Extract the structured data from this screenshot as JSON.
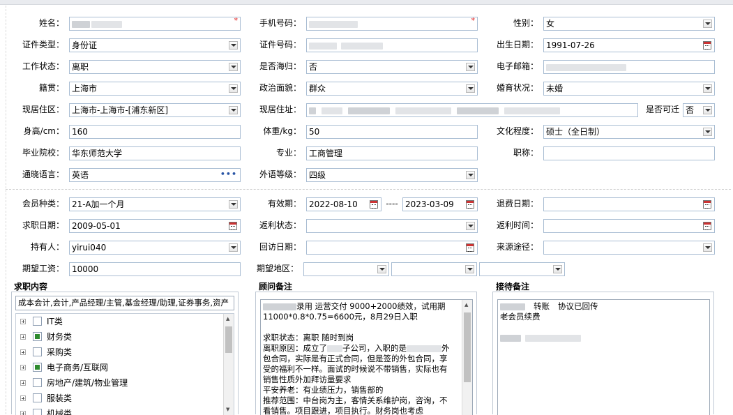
{
  "personal": {
    "name": {
      "label": "姓名："
    },
    "phone": {
      "label": "手机号码："
    },
    "gender": {
      "label": "性别：",
      "value": "女"
    },
    "id_type": {
      "label": "证件类型：",
      "value": "身份证"
    },
    "id_no": {
      "label": "证件号码："
    },
    "birth": {
      "label": "出生日期：",
      "value": "1991-07-26"
    },
    "work_status": {
      "label": "工作状态：",
      "value": "离职"
    },
    "overseas": {
      "label": "是否海归：",
      "value": "否"
    },
    "email": {
      "label": "电子邮箱："
    },
    "origin": {
      "label": "籍贯：",
      "value": "上海市"
    },
    "political": {
      "label": "政治面貌：",
      "value": "群众"
    },
    "marital": {
      "label": "婚育状况：",
      "value": "未婚"
    },
    "residence_area": {
      "label": "现居住区：",
      "value": "上海市-上海市-[浦东新区]"
    },
    "residence_addr": {
      "label": "现居住址："
    },
    "relocate": {
      "label": "是否可迁",
      "value": "否"
    },
    "height": {
      "label": "身高/cm：",
      "value": "160"
    },
    "weight": {
      "label": "体重/kg：",
      "value": "50"
    },
    "education": {
      "label": "文化程度：",
      "value": "硕士（全日制）"
    },
    "school": {
      "label": "毕业院校：",
      "value": "华东师范大学"
    },
    "major": {
      "label": "专业：",
      "value": "工商管理"
    },
    "title": {
      "label": "职称："
    },
    "language": {
      "label": "通晓语言：",
      "value": "英语",
      "more": "•••"
    },
    "lang_level": {
      "label": "外语等级：",
      "value": "四级"
    }
  },
  "membership": {
    "member_type": {
      "label": "会员种类：",
      "value": "21-A加一个月"
    },
    "validity": {
      "label": "有效期：",
      "start": "2022-08-10",
      "sep": "----",
      "end": "2023-03-09"
    },
    "refund_date": {
      "label": "退费日期："
    },
    "job_date": {
      "label": "求职日期：",
      "value": "2009-05-01"
    },
    "rebate_status": {
      "label": "返利状态："
    },
    "rebate_time": {
      "label": "返利时间："
    },
    "holder": {
      "label": "持有人：",
      "value": "yirui040"
    },
    "visit_date": {
      "label": "回访日期："
    },
    "source": {
      "label": "来源途径："
    },
    "salary": {
      "label": "期望工资：",
      "value": "10000"
    },
    "region": {
      "label": "期望地区："
    }
  },
  "job": {
    "title": "求职内容",
    "selected": "成本会计,会计,产品经理/主管,基金经理/助理,证券事务,资产",
    "categories": [
      {
        "label": "IT类",
        "checked": false
      },
      {
        "label": "财务类",
        "checked": true
      },
      {
        "label": "采购类",
        "checked": false
      },
      {
        "label": "电子商务/互联网",
        "checked": true
      },
      {
        "label": "房地产/建筑/物业管理",
        "checked": false
      },
      {
        "label": "服装类",
        "checked": false
      },
      {
        "label": "机械类",
        "checked": false
      }
    ]
  },
  "consultant": {
    "title": "顾问备注",
    "l1": "录用 运营交付 9000+2000绩效，试用期",
    "l2": "11000*0.8*0.75=6600元，8月29日入职",
    "l3": "求职状态：离职 随时到岗",
    "l4a": "离职原因：成立了",
    "l4b": "子公司，入职的是",
    "l4c": "外",
    "l5": "包合同，实际是有正式合同，但是签的外包合同，享",
    "l6": "受的福利不一样。面试的时候说不带销售，实际也有",
    "l7": "销售性质外加拜访量要求",
    "l8": "平安养老：有业绩压力，销售部的",
    "l9": "推荐范围：中台岗为主，客情关系维护岗，咨询，不",
    "l10": "看销售。项目跟进，项目执行。财务岗也考虑"
  },
  "reception": {
    "title": "接待备注",
    "l1a": "转账",
    "l1b": "协议已回传",
    "l2": "老会员续费"
  },
  "colors": {
    "required": "#e02020",
    "border": "#a9bdd3",
    "checked": "#2e8b2e"
  }
}
